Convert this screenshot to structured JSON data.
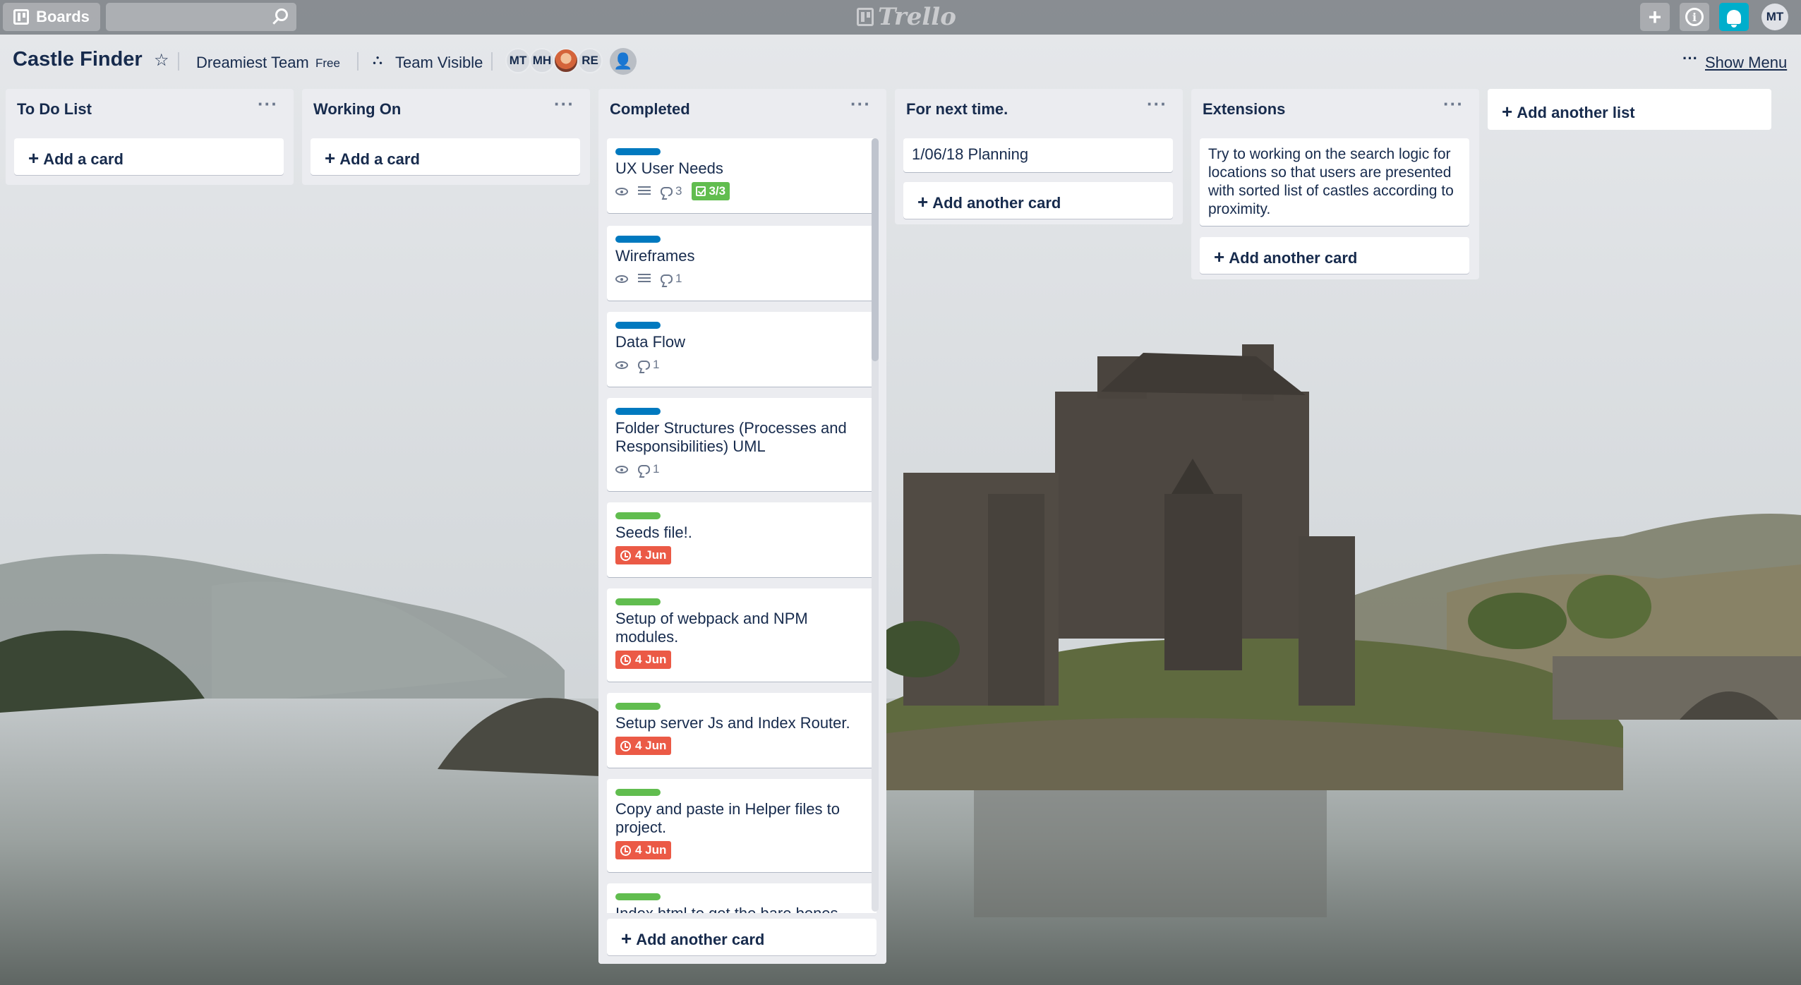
{
  "topbar": {
    "boards_label": "Boards",
    "logo_text": "Trello",
    "search_value": "",
    "user_initials": "MT"
  },
  "board": {
    "title": "Castle Finder",
    "team": "Dreamiest Team",
    "plan": "Free",
    "visibility": "Team Visible",
    "members": [
      "MT",
      "MH",
      "",
      "RE"
    ],
    "menu_dots": "···",
    "show_menu": "Show Menu"
  },
  "lists": [
    {
      "title": "To Do List",
      "menu": "···",
      "add_card": "Add a card",
      "cards": []
    },
    {
      "title": "Working On",
      "menu": "···",
      "add_card": "Add a card",
      "cards": []
    },
    {
      "title": "Completed",
      "menu": "···",
      "add_card": "Add another card",
      "cards": [
        {
          "title": "UX User Needs",
          "label": "blue",
          "watch": true,
          "desc": true,
          "comments": "3",
          "checklist": "3/3"
        },
        {
          "title": "Wireframes",
          "label": "blue",
          "watch": true,
          "desc": true,
          "comments": "1"
        },
        {
          "title": "Data Flow",
          "label": "blue",
          "watch": true,
          "comments": "1"
        },
        {
          "title": "Folder Structures (Processes and Responsibilities) UML",
          "label": "blue",
          "watch": true,
          "comments": "1"
        },
        {
          "title": "Seeds file!.",
          "label": "green",
          "due": "4 Jun"
        },
        {
          "title": "Setup of webpack and NPM modules.",
          "label": "green",
          "due": "4 Jun"
        },
        {
          "title": "Setup server Js and Index Router.",
          "label": "green",
          "due": "4 Jun"
        },
        {
          "title": "Copy and paste in Helper files to project.",
          "label": "green",
          "due": "4 Jun"
        },
        {
          "title": "Index.html to get the bare bones",
          "label": "green"
        }
      ]
    },
    {
      "title": "For next time.",
      "menu": "···",
      "add_card": "Add another card",
      "cards": [
        {
          "title": "1/06/18 Planning"
        }
      ]
    },
    {
      "title": "Extensions",
      "menu": "···",
      "add_card": "Add another card",
      "cards": [
        {
          "title": "Try to working on the search logic for locations so that users are presented with sorted list of castles according to proximity."
        }
      ]
    }
  ],
  "add_list": "Add another list",
  "colors": {
    "label_blue": "#0079bf",
    "label_green": "#61bd4f",
    "due_red": "#eb5a46",
    "notify_cyan": "#00aecc",
    "list_bg": "#ebecf0"
  }
}
